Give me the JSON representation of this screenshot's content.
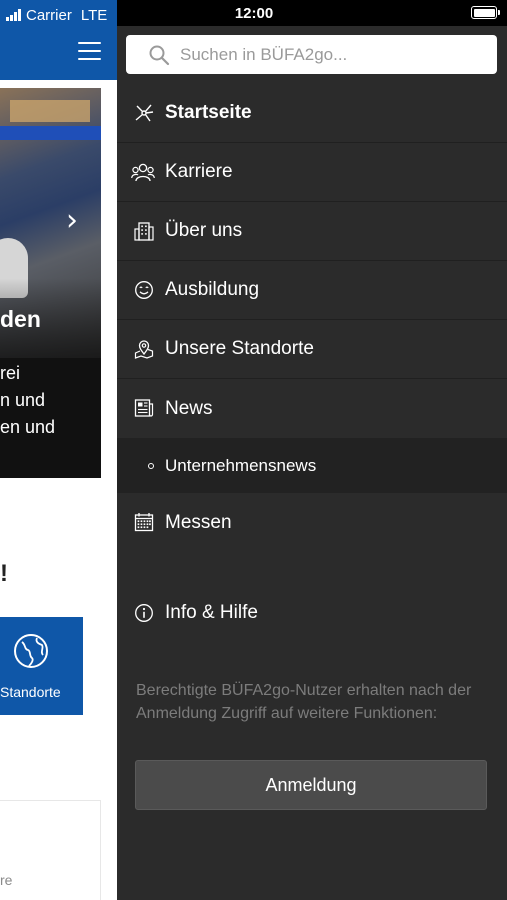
{
  "status": {
    "carrier": "Carrier",
    "network": "LTE",
    "time": "12:00"
  },
  "background_app": {
    "banner_title": "den",
    "banner_lines": [
      "rei",
      "n und",
      "en und"
    ],
    "heading": "!",
    "tile_label": "Standorte",
    "card_text": "re",
    "colors": {
      "brand": "#0f57a8"
    }
  },
  "search": {
    "placeholder": "Suchen in BÜFA2go..."
  },
  "menu": {
    "items": [
      {
        "label": "Startseite",
        "icon": "network-icon",
        "active": true
      },
      {
        "label": "Karriere",
        "icon": "people-icon"
      },
      {
        "label": "Über uns",
        "icon": "building-icon"
      },
      {
        "label": "Ausbildung",
        "icon": "smiley-icon"
      },
      {
        "label": "Unsere Standorte",
        "icon": "map-pin-icon"
      },
      {
        "label": "News",
        "icon": "newspaper-icon"
      }
    ],
    "news_subitem": {
      "label": "Unternehmensnews"
    },
    "messen": {
      "label": "Messen",
      "icon": "calendar-icon"
    },
    "info": {
      "label": "Info & Hilfe",
      "icon": "info-icon"
    }
  },
  "login": {
    "note": "Berechtigte BÜFA2go-Nutzer erhalten nach der Anmeldung Zugriff auf weitere Funktionen:",
    "button_label": "Anmeldung"
  },
  "colors": {
    "drawer_bg": "#2b2b2b",
    "divider": "#202020",
    "subitem_bg": "#222222",
    "button_bg": "#4b4b4b"
  }
}
